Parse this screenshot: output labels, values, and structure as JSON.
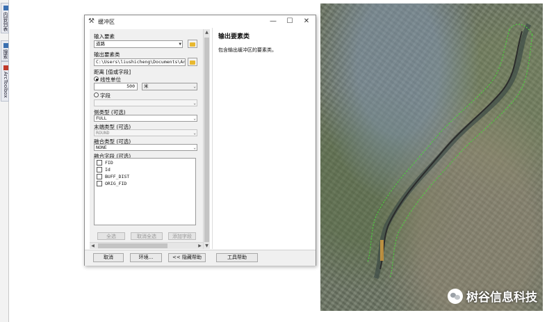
{
  "left_toolbar": {
    "tabs": [
      {
        "label": "内容列表",
        "icon": "table-of-contents-icon"
      },
      {
        "label": "搜索",
        "icon": "search-icon"
      },
      {
        "label": "ArcToolbox",
        "icon": "toolbox-icon"
      }
    ]
  },
  "dialog": {
    "title": "缓冲区",
    "title_icon": "hammer-tool-icon",
    "controls": {
      "minimize": "—",
      "maximize": "☐",
      "close": "✕"
    },
    "form": {
      "input_label": "输入要素",
      "input_value": "道路",
      "output_label": "输出要素类",
      "output_value": "C:\\Users\\liushicheng\\Documents\\ArcGI",
      "distance_label": "距离 [值或字段]",
      "linear_unit_label": "线性单位",
      "distance_value": "500",
      "unit_value": "米",
      "field_label": "字段",
      "side_type_label": "侧类型 (可选)",
      "side_type_value": "FULL",
      "end_type_label": "末端类型 (可选)",
      "end_type_value": "ROUND",
      "dissolve_type_label": "融合类型 (可选)",
      "dissolve_type_value": "NONE",
      "dissolve_field_label": "融合字段 (可选)",
      "dissolve_fields": [
        "FID",
        "Id",
        "BUFF_DIST",
        "ORIG_FID"
      ],
      "select_all": "全选",
      "unselect_all": "取消全选",
      "add_field": "添加字段"
    },
    "help": {
      "title": "输出要素类",
      "text": "包含输出缓冲区的要素类。"
    },
    "buttons": {
      "cancel": "取消",
      "environments": "环境...",
      "hide_help": "<< 隐藏帮助",
      "tool_help": "工具帮助"
    }
  },
  "watermark": {
    "text": "树谷信息科技",
    "icon": "wechat-logo-icon"
  },
  "colors": {
    "buffer_line": "#4cd13c",
    "road_line": "#2b2b2b",
    "river": "#3c4a46"
  }
}
